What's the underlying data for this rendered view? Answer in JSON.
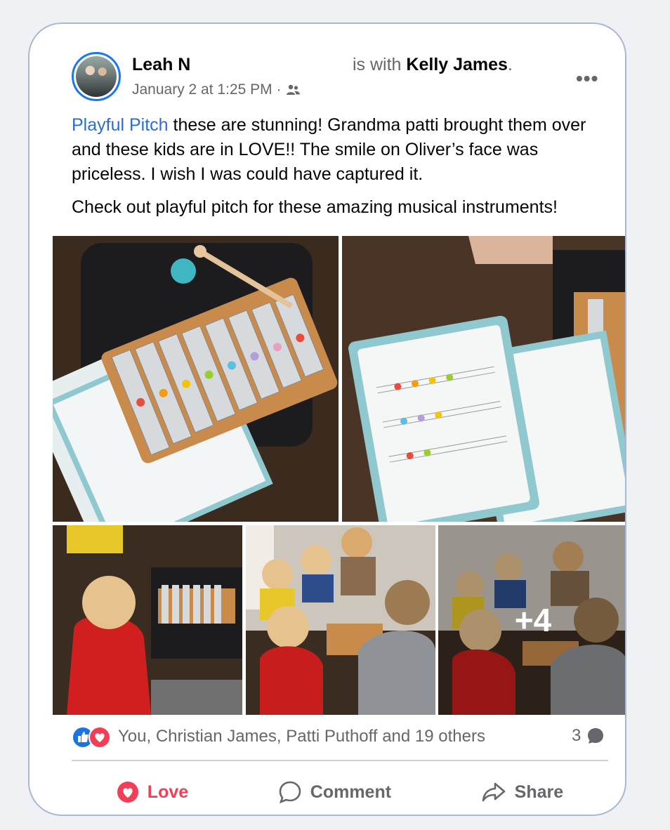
{
  "post": {
    "author": "Leah N",
    "with_prefix": "is with",
    "with_name": "Kelly James",
    "with_suffix": ".",
    "timestamp": "January 2 at 1:25 PM ·",
    "audience_icon": "friends-icon",
    "tag": "Playful Pitch",
    "text_1_rest": " these are stunning! Grandma patti brought them over and these kids are in LOVE!! The smile on Oliver’s face was priceless. I wish I was could have captured it.",
    "text_2": "Check out playful pitch for these amazing musical instruments!",
    "more_photos": "+4"
  },
  "reactions": {
    "summary": "You, Christian James, Patti Puthoff and 19 others",
    "comments_count": "3",
    "icons": [
      "like-icon",
      "love-icon"
    ]
  },
  "actions": {
    "love": "Love",
    "comment": "Comment",
    "share": "Share"
  },
  "colors": {
    "link": "#2a6fcf",
    "love": "#f33e58",
    "like": "#1b74e4",
    "muted": "#65676b"
  }
}
